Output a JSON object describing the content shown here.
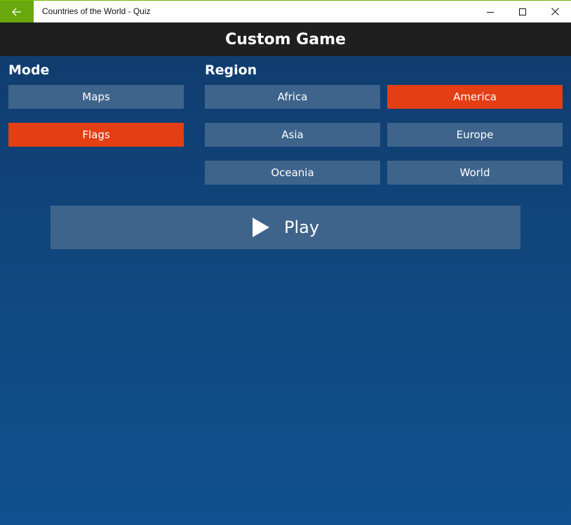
{
  "window": {
    "title": "Countries of the World - Quiz"
  },
  "header": {
    "title": "Custom Game"
  },
  "mode": {
    "label": "Mode",
    "options": [
      {
        "label": "Maps",
        "selected": false
      },
      {
        "label": "Flags",
        "selected": true
      }
    ]
  },
  "region": {
    "label": "Region",
    "options": [
      {
        "label": "Africa",
        "selected": false
      },
      {
        "label": "America",
        "selected": true
      },
      {
        "label": "Asia",
        "selected": false
      },
      {
        "label": "Europe",
        "selected": false
      },
      {
        "label": "Oceania",
        "selected": false
      },
      {
        "label": "World",
        "selected": false
      }
    ]
  },
  "play": {
    "label": "Play",
    "icon": "play-icon"
  },
  "colors": {
    "accent_selected": "#e43e15",
    "button": "#3e648c",
    "header_bg": "#1f1f1f",
    "back_button": "#69a80c"
  }
}
